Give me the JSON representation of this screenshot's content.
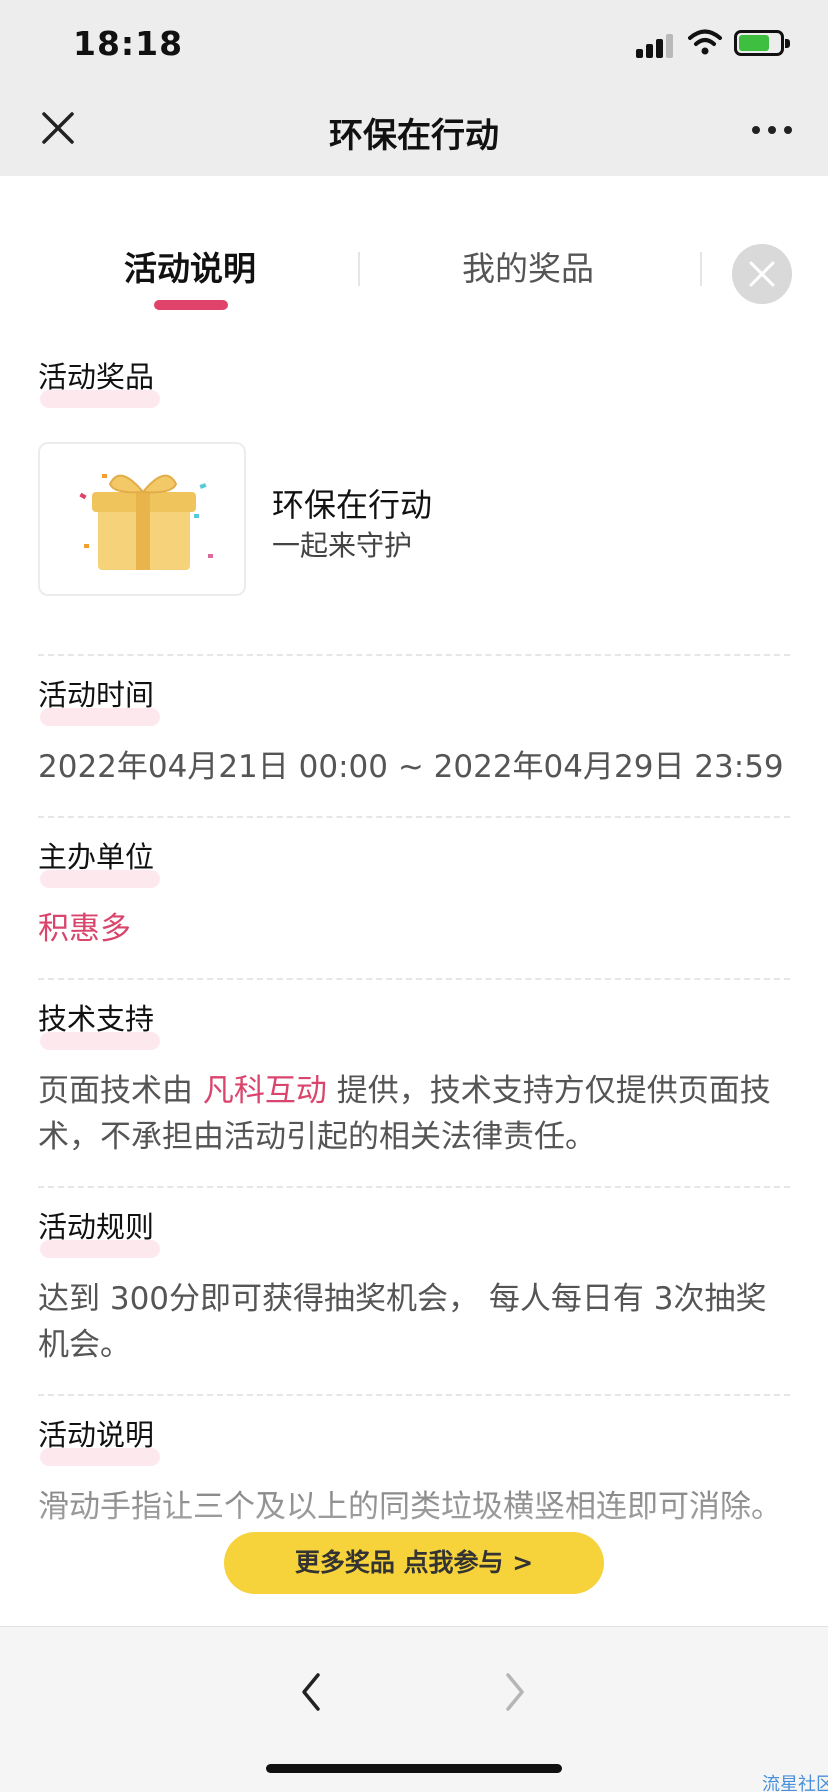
{
  "status_bar": {
    "time": "18:18"
  },
  "nav": {
    "title": "环保在行动"
  },
  "tabs": [
    {
      "label": "活动说明",
      "active": true
    },
    {
      "label": "我的奖品",
      "active": false
    }
  ],
  "prize_section": {
    "heading": "活动奖品",
    "prize_name": "环保在行动",
    "prize_subtitle": "一起来守护"
  },
  "time_section": {
    "heading": "活动时间",
    "value": "2022年04月21日 00:00 ~ 2022年04月29日 23:59"
  },
  "organizer_section": {
    "heading": "主办单位",
    "value": "积惠多"
  },
  "tech_section": {
    "heading": "技术支持",
    "text_before": "页面技术由",
    "provider": "凡科互动",
    "text_after": "提供，技术支持方仅提供页面技术，不承担由活动引起的相关法律责任。"
  },
  "rules_section": {
    "heading": "活动规则",
    "text": "达到 300分即可获得抽奖机会， 每人每日有 3次抽奖机会。"
  },
  "description_section": {
    "heading": "活动说明",
    "text": "滑动手指让三个及以上的同类垃圾横竖相连即可消除。"
  },
  "cta": {
    "label": "更多奖品   点我参与 >"
  },
  "watermark": "流星社区",
  "colors": {
    "accent": "#e0426a",
    "link": "#d9456d",
    "cta": "#f6d23b",
    "header_bg": "#ededed"
  }
}
